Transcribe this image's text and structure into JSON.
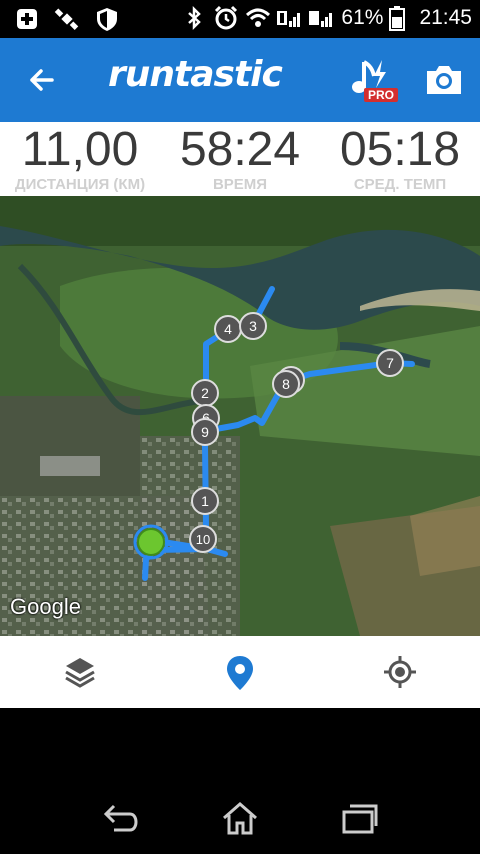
{
  "status_bar": {
    "battery_text": "61%",
    "time": "21:45",
    "icons": [
      "add-icon",
      "satellite-icon",
      "shield-icon",
      "bluetooth-icon",
      "alarm-icon",
      "wifi-icon",
      "signal-1-icon",
      "signal-2-icon",
      "battery-icon"
    ]
  },
  "app_bar": {
    "logo": "runtastic",
    "back_icon": "arrow-left-icon",
    "music_icon": "music-bolt-icon",
    "pro_badge": "PRO",
    "camera_icon": "camera-icon",
    "color": "#1e7ad2"
  },
  "stats": [
    {
      "value": "11,00",
      "label": "ДИСТАНЦИЯ (КМ)"
    },
    {
      "value": "58:24",
      "label": "ВРЕМЯ"
    },
    {
      "value": "05:18",
      "label": "СРЕД. ТЕМП"
    }
  ],
  "map": {
    "attribution": "Google",
    "route_color": "#2b8af0",
    "km_markers": [
      "1",
      "2",
      "3",
      "4",
      "5",
      "6",
      "7",
      "8",
      "9",
      "10"
    ],
    "start_color": "#6cc62f"
  },
  "toolbar": {
    "layers_icon": "layers-icon",
    "location_icon": "map-pin-icon",
    "gps_icon": "gps-target-icon",
    "accent": "#1e7ad2"
  },
  "nav_bar": {
    "back_icon": "nav-back-icon",
    "home_icon": "nav-home-icon",
    "recents_icon": "nav-recents-icon"
  }
}
